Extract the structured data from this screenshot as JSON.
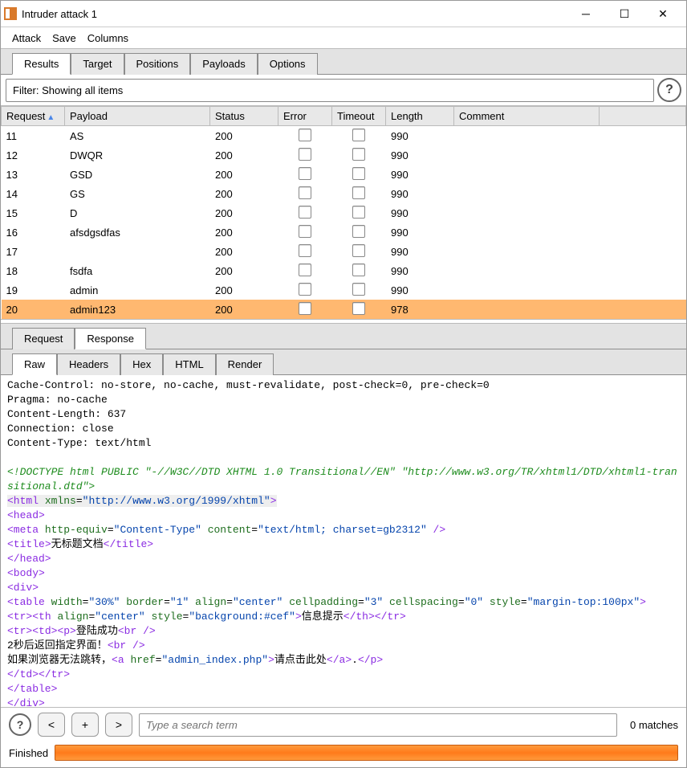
{
  "window": {
    "title": "Intruder attack 1"
  },
  "menu": {
    "attack": "Attack",
    "save": "Save",
    "columns": "Columns"
  },
  "main_tabs": [
    "Results",
    "Target",
    "Positions",
    "Payloads",
    "Options"
  ],
  "main_tab_active": 0,
  "filter_text": "Filter: Showing all items",
  "columns": {
    "request": "Request",
    "payload": "Payload",
    "status": "Status",
    "error": "Error",
    "timeout": "Timeout",
    "length": "Length",
    "comment": "Comment"
  },
  "rows": [
    {
      "req": "11",
      "payload": "AS",
      "status": "200",
      "len": "990",
      "sel": false
    },
    {
      "req": "12",
      "payload": "DWQR",
      "status": "200",
      "len": "990",
      "sel": false
    },
    {
      "req": "13",
      "payload": "GSD",
      "status": "200",
      "len": "990",
      "sel": false
    },
    {
      "req": "14",
      "payload": "GS",
      "status": "200",
      "len": "990",
      "sel": false
    },
    {
      "req": "15",
      "payload": "D",
      "status": "200",
      "len": "990",
      "sel": false
    },
    {
      "req": "16",
      "payload": "afsdgsdfas",
      "status": "200",
      "len": "990",
      "sel": false
    },
    {
      "req": "17",
      "payload": "",
      "status": "200",
      "len": "990",
      "sel": false
    },
    {
      "req": "18",
      "payload": "fsdfa",
      "status": "200",
      "len": "990",
      "sel": false
    },
    {
      "req": "19",
      "payload": "admin",
      "status": "200",
      "len": "990",
      "sel": false
    },
    {
      "req": "20",
      "payload": "admin123",
      "status": "200",
      "len": "978",
      "sel": true
    }
  ],
  "mid_tabs": {
    "request": "Request",
    "response": "Response"
  },
  "mid_tab_active": "response",
  "sub_tabs": [
    "Raw",
    "Headers",
    "Hex",
    "HTML",
    "Render"
  ],
  "sub_tab_active": 0,
  "headers_text": "Cache-Control: no-store, no-cache, must-revalidate, post-check=0, pre-check=0\nPragma: no-cache\nContent-Length: 637\nConnection: close\nContent-Type: text/html",
  "html_doc": {
    "doctype": "<!DOCTYPE html PUBLIC \"-//W3C//DTD XHTML 1.0 Transitional//EN\" \"http://www.w3.org/TR/xhtml1/DTD/xhtml1-transitional.dtd\">",
    "xmlns": "http://www.w3.org/1999/xhtml",
    "meta_equiv": "Content-Type",
    "meta_content": "text/html; charset=gb2312",
    "title": "无标题文档",
    "table_attrs": {
      "width": "30%",
      "border": "1",
      "align": "center",
      "cellpadding": "3",
      "cellspacing": "0",
      "style": "margin-top:100px"
    },
    "th_align": "center",
    "th_style": "background:#cef",
    "th_text": "信息提示",
    "p_text1": "登陆成功",
    "msg2": "2秒后返回指定界面！",
    "msg3_prefix": "如果浏览器无法跳转，",
    "a_href": "admin_index.php",
    "a_text": "请点击此处",
    "msg3_suffix": "."
  },
  "nav": {
    "prev": "<",
    "add": "+",
    "next": ">"
  },
  "search_placeholder": "Type a search term",
  "matches_text": "0 matches",
  "status": {
    "label": "Finished"
  }
}
